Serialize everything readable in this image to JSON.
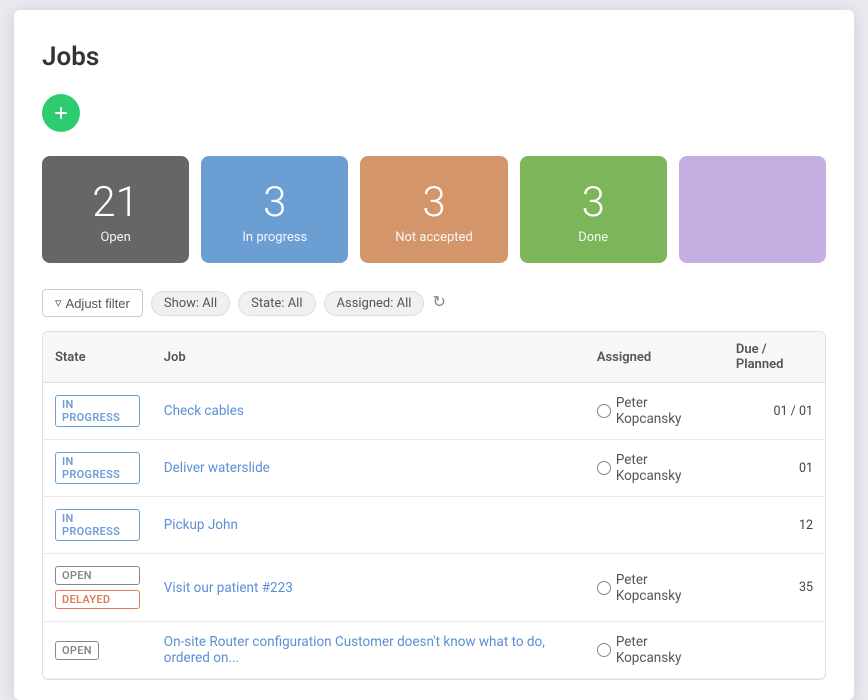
{
  "page": {
    "title": "Jobs",
    "add_button_label": "+"
  },
  "stat_cards": [
    {
      "id": "open",
      "number": "21",
      "label": "Open",
      "class": "card-open"
    },
    {
      "id": "inprogress",
      "number": "3",
      "label": "In progress",
      "class": "card-inprogress"
    },
    {
      "id": "notaccepted",
      "number": "3",
      "label": "Not accepted",
      "class": "card-notaccepted"
    },
    {
      "id": "done",
      "number": "3",
      "label": "Done",
      "class": "card-done"
    },
    {
      "id": "extra",
      "number": "",
      "label": "",
      "class": "card-extra"
    }
  ],
  "filter_bar": {
    "adjust_filter_label": "Adjust filter",
    "show_label": "Show:",
    "show_value": "All",
    "state_label": "State:",
    "state_value": "All",
    "assigned_label": "Assigned:",
    "assigned_value": "All"
  },
  "table": {
    "columns": [
      "State",
      "Job",
      "Assigned",
      "Due / Planned"
    ],
    "rows": [
      {
        "badges": [
          "IN PROGRESS"
        ],
        "badge_types": [
          "inprogress"
        ],
        "job": "Check cables",
        "assigned": "Peter Kopcansky",
        "due": "01 / 01"
      },
      {
        "badges": [
          "IN PROGRESS"
        ],
        "badge_types": [
          "inprogress"
        ],
        "job": "Deliver waterslide",
        "assigned": "Peter Kopcansky",
        "due": "01"
      },
      {
        "badges": [
          "IN PROGRESS"
        ],
        "badge_types": [
          "inprogress"
        ],
        "job": "Pickup John",
        "assigned": "",
        "due": "12"
      },
      {
        "badges": [
          "OPEN",
          "DELAYED"
        ],
        "badge_types": [
          "open",
          "delayed"
        ],
        "job": "Visit our patient #223",
        "assigned": "Peter Kopcansky",
        "due": "35"
      },
      {
        "badges": [
          "OPEN"
        ],
        "badge_types": [
          "open"
        ],
        "job": "On-site Router configuration Customer doesn't know what to do, ordered on...",
        "assigned": "Peter Kopcansky",
        "due": ""
      }
    ]
  }
}
